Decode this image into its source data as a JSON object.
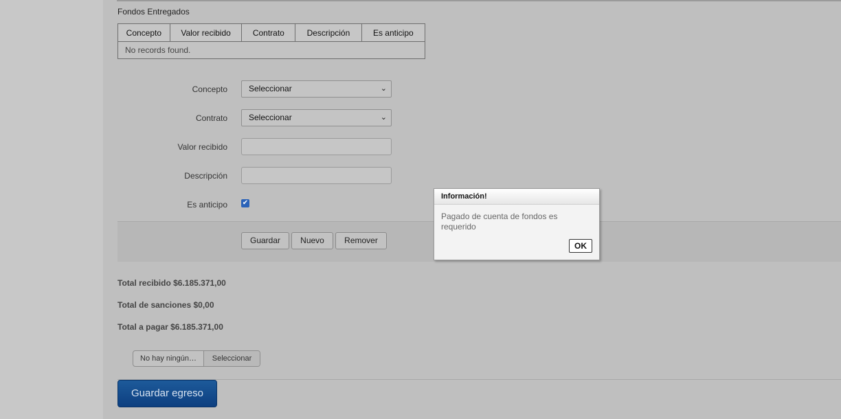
{
  "fondos": {
    "title": "Fondos Entregados",
    "columns": [
      "Concepto",
      "Valor recibido",
      "Contrato",
      "Descripción",
      "Es anticipo"
    ],
    "empty_message": "No records found."
  },
  "form": {
    "concepto": {
      "label": "Concepto",
      "value": "Seleccionar"
    },
    "contrato": {
      "label": "Contrato",
      "value": "Seleccionar"
    },
    "valor_recibido": {
      "label": "Valor recibido",
      "value": ""
    },
    "descripcion": {
      "label": "Descripción",
      "value": ""
    },
    "es_anticipo": {
      "label": "Es anticipo",
      "checked": true
    }
  },
  "actions": {
    "guardar": "Guardar",
    "nuevo": "Nuevo",
    "remover": "Remover"
  },
  "totals": {
    "recibido": "Total recibido $6.185.371,00",
    "sanciones": "Total de sanciones $0,00",
    "a_pagar": "Total a pagar $6.185.371,00"
  },
  "file": {
    "name": "No hay ningún…",
    "button": "Seleccionar"
  },
  "save_button": "Guardar egreso",
  "dialog": {
    "title": "Información!",
    "message": "Pagado de cuenta de fondos es requerido",
    "ok": "OK"
  },
  "colors": {
    "primary": "#0d3f80",
    "checkbox": "#2b63b8"
  }
}
